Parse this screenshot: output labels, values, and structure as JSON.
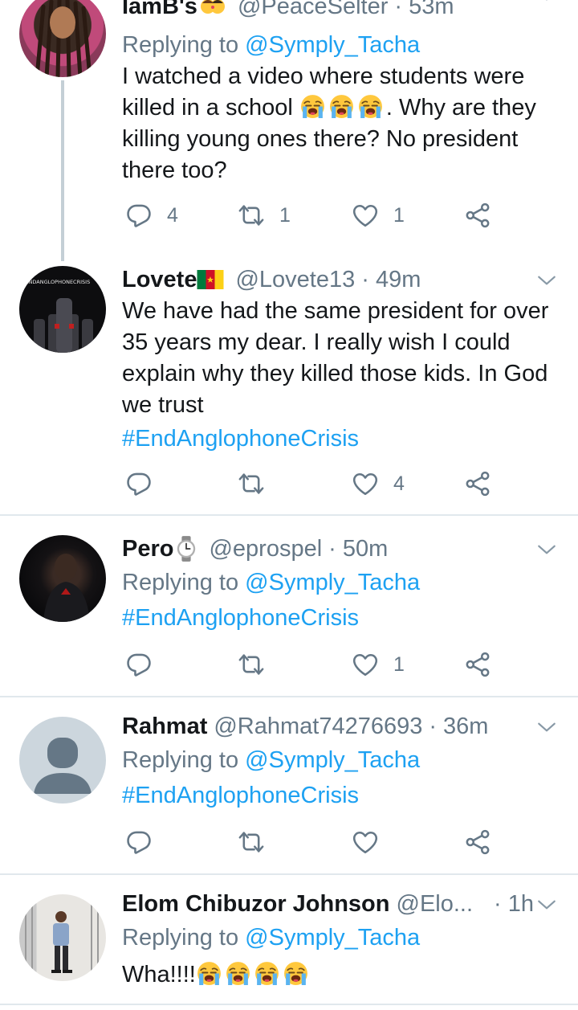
{
  "tweets": [
    {
      "name": "IamB's",
      "handle": "@PeaceSelter",
      "time": "53m",
      "replying_prefix": "Replying to ",
      "replying_to": "@Symply_Tacha",
      "text_1": "I watched a video where students were killed in a school",
      "text_2": ". Why are they killing young ones there? No president there too?",
      "reply_count": "4",
      "retweet_count": "1",
      "like_count": "1",
      "name_emoji": "kissing-couple-emoji",
      "inline_emoji": "loudly-crying-face-emoji"
    },
    {
      "name": "Lovete",
      "flag": "cameroon-flag",
      "handle": "@Lovete13",
      "time": "49m",
      "avatar_text": "#ENDANGLOPHONECRISIS",
      "text": "We have had the same president for over 35 years my dear. I really wish I could explain why they killed those kids. In God we trust",
      "hashtag": "#EndAnglophoneCrisis",
      "reply_count": "",
      "retweet_count": "",
      "like_count": "4"
    },
    {
      "name": "Pero",
      "name_emoji": "watch-emoji",
      "handle": "@eprospel",
      "time": "50m",
      "replying_prefix": "Replying to ",
      "replying_to": "@Symply_Tacha",
      "hashtag": "#EndAnglophoneCrisis",
      "reply_count": "",
      "retweet_count": "",
      "like_count": "1"
    },
    {
      "name": "Rahmat",
      "handle": "@Rahmat74276693",
      "time": "36m",
      "replying_prefix": "Replying to ",
      "replying_to": "@Symply_Tacha",
      "hashtag": "#EndAnglophoneCrisis",
      "reply_count": "",
      "retweet_count": "",
      "like_count": ""
    },
    {
      "name": "Elom Chibuzor Johnson",
      "handle": "@Elo...",
      "time": "1h",
      "replying_prefix": "Replying to ",
      "replying_to": "@Symply_Tacha",
      "text": "Wha!!!!"
    }
  ],
  "separator": "·",
  "colors": {
    "link": "#1da1f2",
    "muted": "#657786",
    "text": "#14171a",
    "divider": "#e1e8ed"
  }
}
